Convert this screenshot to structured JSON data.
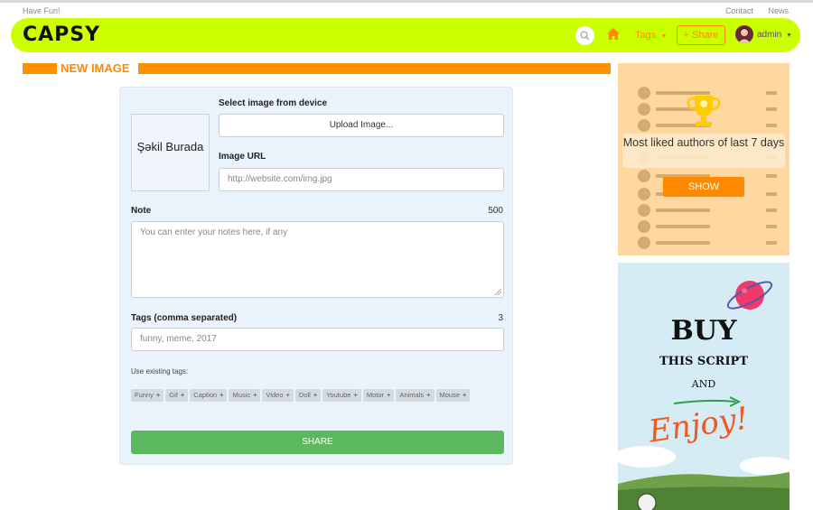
{
  "topbar": {
    "tagline": "Have Fun!",
    "links": [
      "Contact",
      "News"
    ]
  },
  "nav": {
    "logo": "CAPSY",
    "tags_label": "Tags",
    "share_label": "+ Share",
    "user": "admin"
  },
  "section": {
    "title": "NEW IMAGE"
  },
  "form": {
    "image_placeholder": "Şəkil Burada",
    "select_label": "Select image from device",
    "upload_button": "Upload Image...",
    "url_label": "Image URL",
    "url_placeholder": "http://website.com/img.jpg",
    "note_label": "Note",
    "note_counter": "500",
    "note_placeholder": "You can enter your notes here, if any",
    "tags_label": "Tags (comma separated)",
    "tags_counter": "3",
    "tags_placeholder": "funny, meme, 2017",
    "existing_label": "Use existing tags:",
    "existing_tags": [
      "Funny",
      "Gif",
      "Caption",
      "Music",
      "Video",
      "Doll",
      "Youtube",
      "Motor",
      "Animals",
      "Mouse"
    ],
    "share_button": "SHARE"
  },
  "sidebar": {
    "promo_text": "Most liked authors of last 7 days",
    "promo_button": "SHOW"
  },
  "ad": {
    "line1": "BUY",
    "line2": "THIS SCRIPT",
    "line3": "AND",
    "line4": "Enjoy!"
  },
  "colors": {
    "brand": "#ccff00",
    "accent": "#ff8a00",
    "share": "#5cb85c"
  }
}
